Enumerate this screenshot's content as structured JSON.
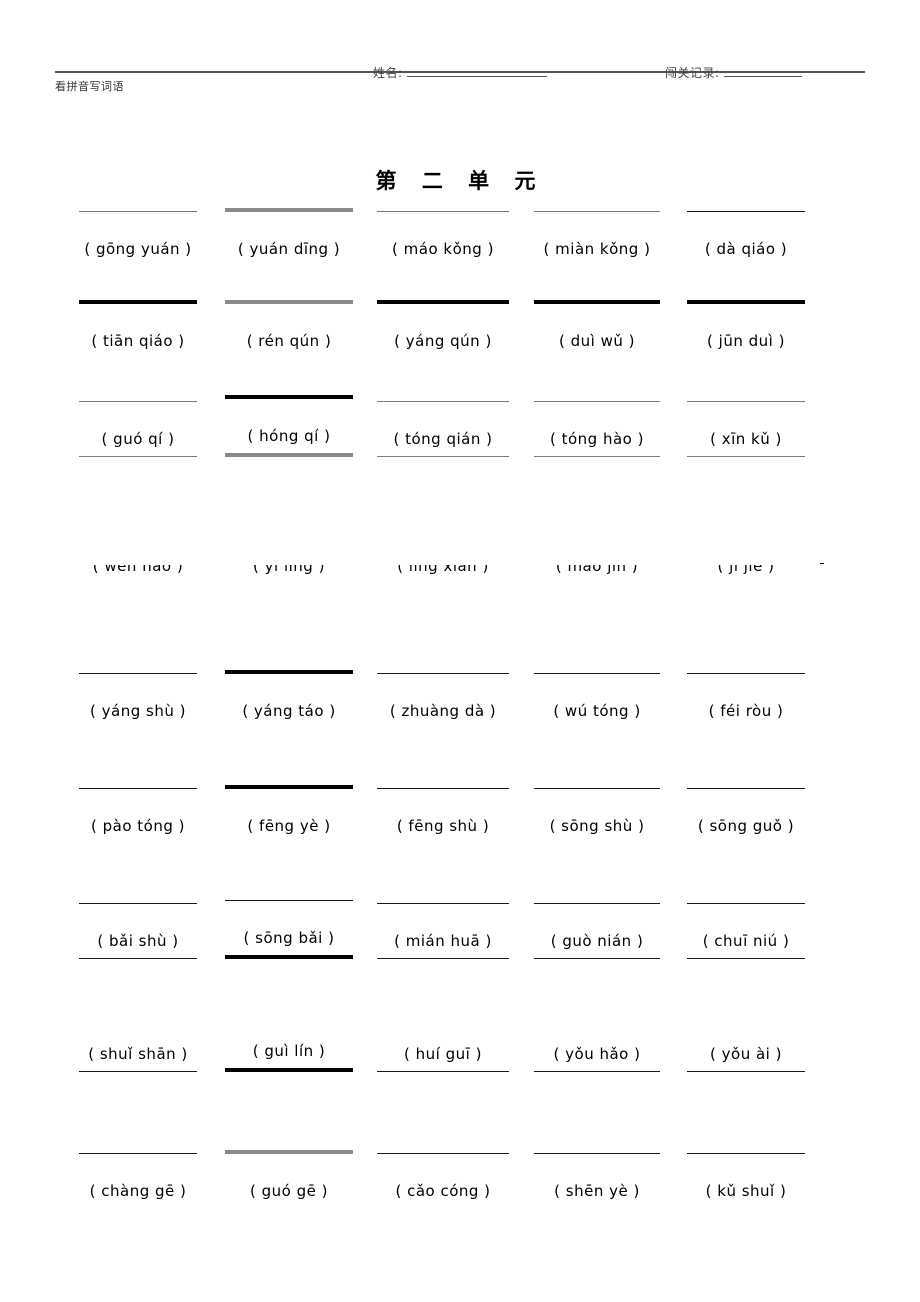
{
  "header": {
    "left_label": "看拼音写词语",
    "name_label": "姓名:",
    "name_value": "",
    "record_label": "闯关记录:",
    "record_value": ""
  },
  "title": "第 二 单 元",
  "rows": [
    {
      "id": "row-1",
      "rule_position": "above",
      "items": [
        {
          "pinyin": "( gōng yuán )",
          "rule": "thin"
        },
        {
          "pinyin": "( yuán dīng )",
          "rule": "greythick"
        },
        {
          "pinyin": "( máo kǒng )",
          "rule": "thin"
        },
        {
          "pinyin": "( miàn kǒng )",
          "rule": "thin"
        },
        {
          "pinyin": "( dà qiáo )",
          "rule": "medium"
        }
      ]
    },
    {
      "id": "row-2",
      "rule_position": "above",
      "items": [
        {
          "pinyin": "( tiān qiáo )",
          "rule": "thick"
        },
        {
          "pinyin": "( rén qún )",
          "rule": "greythick"
        },
        {
          "pinyin": "( yáng qún )",
          "rule": "thick"
        },
        {
          "pinyin": "( duì wǔ )",
          "rule": "thick"
        },
        {
          "pinyin": "( jūn duì )",
          "rule": "thick"
        }
      ]
    },
    {
      "id": "row-3",
      "rule_position": "both",
      "items": [
        {
          "pinyin": "( guó qí )",
          "rule": "thin",
          "rule_below": "thin"
        },
        {
          "pinyin": "( hóng qí )",
          "rule": "thick",
          "rule_below": "greythick"
        },
        {
          "pinyin": "( tóng qián )",
          "rule": "thin",
          "rule_below": "thin"
        },
        {
          "pinyin": "( tóng hào )",
          "rule": "thin",
          "rule_below": "thin"
        },
        {
          "pinyin": "( xīn kǔ )",
          "rule": "thin",
          "rule_below": "thin"
        }
      ]
    },
    {
      "id": "row-4",
      "rule_position": "overlap",
      "items": [
        {
          "pinyin": "( wèn hào )",
          "rule": "medium"
        },
        {
          "pinyin": "( yī lǐng )",
          "rule": "medium"
        },
        {
          "pinyin": "( lǐng xiān )",
          "rule": "medium"
        },
        {
          "pinyin": "( máo jīn )",
          "rule": "medium"
        },
        {
          "pinyin": "( jī jié )",
          "rule": "medium"
        }
      ]
    },
    {
      "id": "row-5",
      "rule_position": "above",
      "items": [
        {
          "pinyin": "( yáng shù )",
          "rule": "medium"
        },
        {
          "pinyin": "( yáng táo )",
          "rule": "thick"
        },
        {
          "pinyin": "( zhuàng dà )",
          "rule": "medium"
        },
        {
          "pinyin": "( wú tóng )",
          "rule": "medium"
        },
        {
          "pinyin": "( féi ròu )",
          "rule": "medium"
        }
      ]
    },
    {
      "id": "row-6",
      "rule_position": "above",
      "items": [
        {
          "pinyin": "( pào tóng )",
          "rule": "medium"
        },
        {
          "pinyin": "( fēng yè )",
          "rule": "thick"
        },
        {
          "pinyin": "( fēng shù )",
          "rule": "medium"
        },
        {
          "pinyin": "( sōng shù )",
          "rule": "medium"
        },
        {
          "pinyin": "( sōng guǒ )",
          "rule": "medium"
        }
      ]
    },
    {
      "id": "row-7",
      "rule_position": "both",
      "items": [
        {
          "pinyin": "( bǎi shù )",
          "rule": "medium",
          "rule_below": "medium"
        },
        {
          "pinyin": "( sōng bǎi )",
          "rule": "medium",
          "rule_below": "thick"
        },
        {
          "pinyin": "( mián huā )",
          "rule": "medium",
          "rule_below": "medium"
        },
        {
          "pinyin": "( guò nián )",
          "rule": "medium",
          "rule_below": "medium"
        },
        {
          "pinyin": "( chuī niú )",
          "rule": "medium",
          "rule_below": "medium"
        }
      ]
    },
    {
      "id": "row-8",
      "rule_position": "below",
      "items": [
        {
          "pinyin": "( shuǐ shān )",
          "rule_below": "medium"
        },
        {
          "pinyin": "( guì lín )",
          "rule_below": "thick"
        },
        {
          "pinyin": "( huí guī )",
          "rule_below": "medium"
        },
        {
          "pinyin": "( yǒu hǎo )",
          "rule_below": "medium"
        },
        {
          "pinyin": "( yǒu ài )",
          "rule_below": "medium"
        }
      ]
    },
    {
      "id": "row-9",
      "rule_position": "above",
      "items": [
        {
          "pinyin": "( chàng gē )",
          "rule": "medium"
        },
        {
          "pinyin": "( guó gē )",
          "rule": "greythick"
        },
        {
          "pinyin": "( cǎo cóng )",
          "rule": "medium"
        },
        {
          "pinyin": "( shēn yè )",
          "rule": "medium"
        },
        {
          "pinyin": "( kǔ shuǐ )",
          "rule": "medium"
        }
      ]
    }
  ]
}
